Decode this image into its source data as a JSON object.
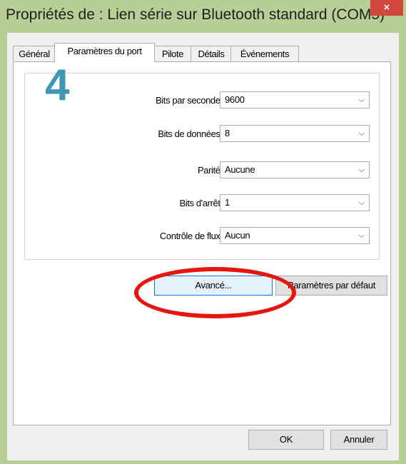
{
  "window": {
    "title": "Propriétés de : Lien série sur Bluetooth standard (COM5)",
    "close_label": "×"
  },
  "tabs": [
    {
      "label": "Général",
      "active": false
    },
    {
      "label": "Paramètres du port",
      "active": true
    },
    {
      "label": "Pilote",
      "active": false
    },
    {
      "label": "Détails",
      "active": false
    },
    {
      "label": "Événements",
      "active": false
    }
  ],
  "annotation": {
    "step_number": "4",
    "step_color": "#3d97b5",
    "highlight_color": "#e8150f"
  },
  "port_settings": {
    "bits_per_second": {
      "label": "Bits par seconde :",
      "value": "9600"
    },
    "data_bits": {
      "label": "Bits de données :",
      "value": "8"
    },
    "parity": {
      "label": "Parité :",
      "value": "Aucune"
    },
    "stop_bits": {
      "label": "Bits d'arrêt :",
      "value": "1"
    },
    "flow_control": {
      "label": "Contrôle de flux :",
      "value": "Aucun"
    }
  },
  "buttons": {
    "advanced": "Avancé...",
    "defaults": "Paramètres par défaut",
    "ok": "OK",
    "cancel": "Annuler"
  },
  "icons": {
    "dropdown": "chevron-down-icon",
    "close": "close-icon"
  }
}
